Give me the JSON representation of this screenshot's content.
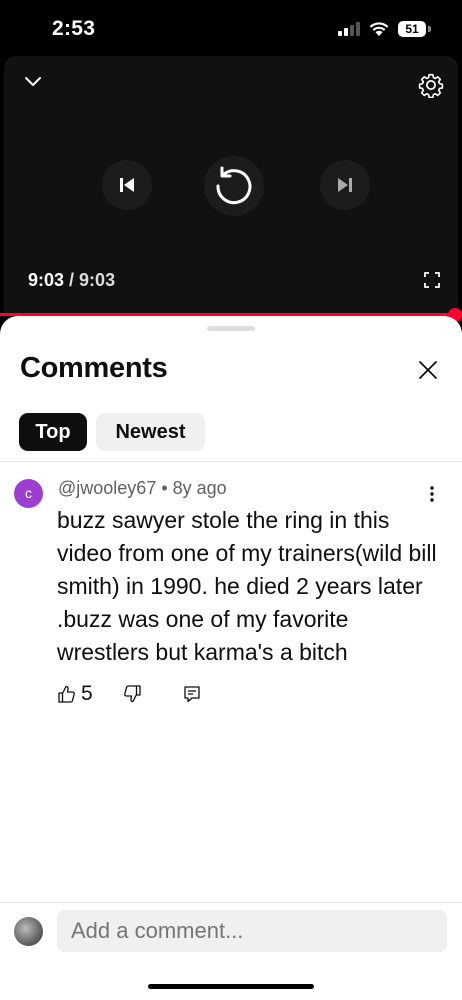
{
  "status_bar": {
    "time": "2:53",
    "battery": "51",
    "battery_level_percent": 51
  },
  "video": {
    "current_time": "9:03",
    "separator": " / ",
    "duration": "9:03",
    "progress_fraction": 1.0,
    "icons": {
      "collapse": "chevron-down-icon",
      "settings": "gear-icon",
      "previous": "skip-previous-icon",
      "replay": "replay-icon",
      "next": "skip-next-icon",
      "fullscreen": "fullscreen-icon"
    }
  },
  "comments": {
    "title": "Comments",
    "filters": [
      {
        "label": "Top",
        "selected": true
      },
      {
        "label": "Newest",
        "selected": false
      }
    ],
    "items": [
      {
        "avatar_letter": "c",
        "author": "@jwooley67",
        "meta_separator": " • ",
        "age": "8y ago",
        "text": "buzz sawyer stole the ring in this video from one of my trainers(wild bill smith) in 1990. he died 2 years later .buzz was one of my favorite wrestlers but karma's a bitch",
        "likes": "5"
      }
    ],
    "add_comment_placeholder": "Add a comment..."
  },
  "colors": {
    "accent_red": "#ff0033",
    "avatar_purple": "#9c3fd1",
    "chip_selected": "#0f0f0f",
    "chip_unselected": "#f0f0f0"
  }
}
